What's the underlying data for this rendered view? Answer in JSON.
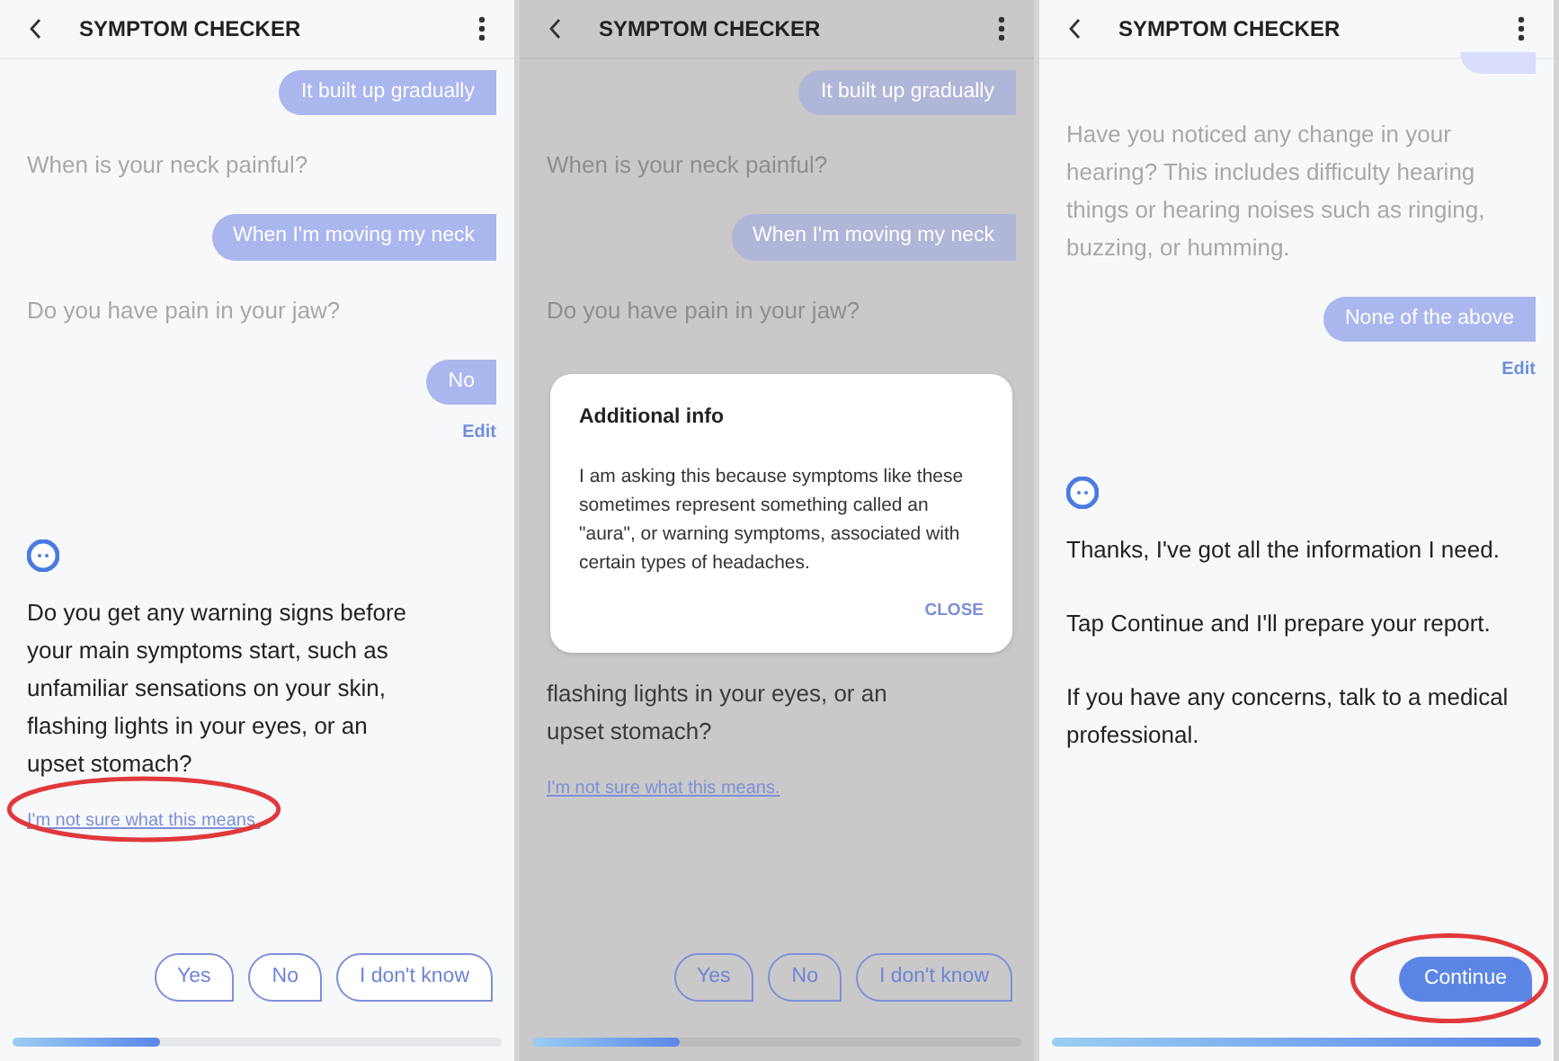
{
  "panels": [
    {
      "title": "SYMPTOM CHECKER",
      "dimmed": false,
      "messages": [
        {
          "kind": "reply",
          "text": "It built up gradually"
        },
        {
          "kind": "question",
          "text": "When is your neck painful?"
        },
        {
          "kind": "reply",
          "text": "When I'm moving my neck"
        },
        {
          "kind": "question",
          "text": "Do you have pain in your jaw?"
        },
        {
          "kind": "reply",
          "text": "No"
        },
        {
          "kind": "edit",
          "text": "Edit"
        },
        {
          "kind": "avatar"
        },
        {
          "kind": "bot",
          "paragraphs": [
            "Do you get any warning signs before your main symptoms start, such as unfamiliar sensations on your skin, flashing lights in your eyes, or an upset stomach?"
          ]
        },
        {
          "kind": "link",
          "text": "I'm not sure what this means.",
          "circled": true
        }
      ],
      "answers": [
        {
          "label": "Yes",
          "kind": "outline",
          "circled": false
        },
        {
          "label": "No",
          "kind": "outline",
          "circled": false
        },
        {
          "label": "I don't know",
          "kind": "outline",
          "circled": false
        }
      ],
      "progress": {
        "level": 0.3
      }
    },
    {
      "title": "SYMPTOM CHECKER",
      "dimmed": true,
      "messages": [
        {
          "kind": "reply",
          "text": "It built up gradually"
        },
        {
          "kind": "question",
          "text": "When is your neck painful?"
        },
        {
          "kind": "reply",
          "text": "When I'm moving my neck"
        },
        {
          "kind": "question",
          "text": "Do you have pain in your jaw?"
        },
        {
          "kind": "dialog",
          "title": "Additional info",
          "body": "I am asking this because symptoms like these sometimes represent something called an \"aura\", or warning symptoms, associated with certain types of headaches.",
          "action": "CLOSE"
        },
        {
          "kind": "bot",
          "paragraphs": [
            "flashing lights in your eyes, or an upset stomach?"
          ]
        },
        {
          "kind": "link",
          "text": "I'm not sure what this means.",
          "circled": false
        }
      ],
      "answers": [
        {
          "label": "Yes",
          "kind": "outline",
          "circled": false
        },
        {
          "label": "No",
          "kind": "outline",
          "circled": false
        },
        {
          "label": "I don't know",
          "kind": "outline",
          "circled": false
        }
      ],
      "progress": {
        "level": 0.3
      }
    },
    {
      "title": "SYMPTOM CHECKER",
      "dimmed": false,
      "messages": [
        {
          "kind": "stub"
        },
        {
          "kind": "question",
          "text": "Have you noticed any change in your hearing? This includes difficulty hearing things or hearing noises such as ringing, buzzing, or humming."
        },
        {
          "kind": "reply",
          "text": "None of the above"
        },
        {
          "kind": "edit",
          "text": "Edit"
        },
        {
          "kind": "avatar"
        },
        {
          "kind": "bot",
          "paragraphs": [
            "Thanks, I've got all the information I need.",
            "Tap Continue and I'll prepare your report.",
            "If you have any concerns, talk to a medical professional."
          ]
        }
      ],
      "answers": [
        {
          "label": "Continue",
          "kind": "filled",
          "circled": true
        }
      ],
      "progress": {
        "level": 1
      }
    }
  ]
}
